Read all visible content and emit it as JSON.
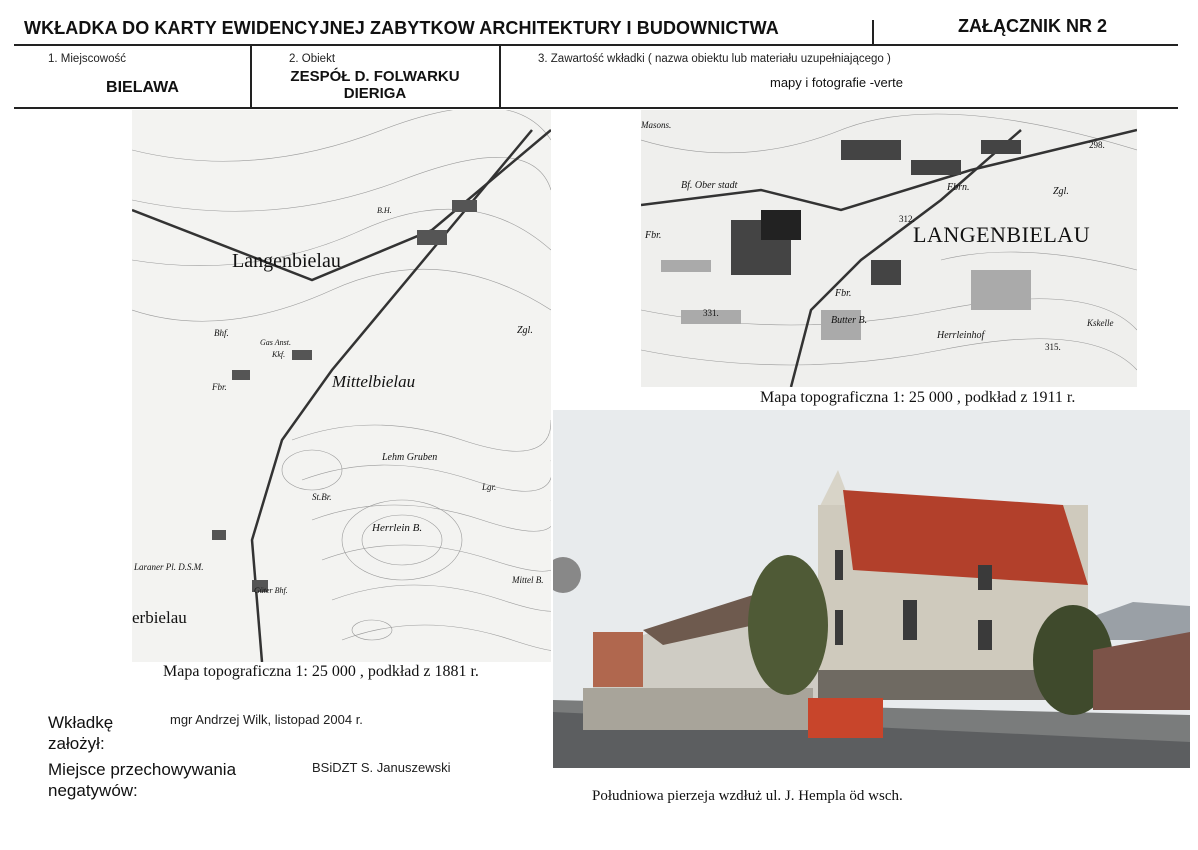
{
  "header": {
    "title": "WKŁADKA DO KARTY EWIDENCYJNEJ ZABYTKOW ARCHITEKTURY I BUDOWNICTWA",
    "annex": "ZAŁĄCZNIK NR  2"
  },
  "fields": {
    "locality": {
      "label": "1. Miejscowość",
      "value": "BIELAWA"
    },
    "object": {
      "label": "2. Obiekt",
      "value_line1": "ZESPÓŁ D. FOLWARKU",
      "value_line2": "DIERIGA"
    },
    "content": {
      "label": "3. Zawartość wkładki ( nazwa obiektu lub materiału uzupełniającego )",
      "value": "mapy i fotografie -verte"
    }
  },
  "maps": {
    "map1881": {
      "caption": "Mapa topograficzna 1: 25 000 , podkład z 1881 r.",
      "labels": [
        "Langenbielau",
        "Mittelbielau",
        "erbielau",
        "Herrlein B.",
        "Lehm Gruben",
        "Zgl.",
        "Fbr.",
        "Bhf.",
        "St.Br.",
        "Lgr.",
        "Mittel B.",
        "Laraner Pl. D.S.M.",
        "Güter Bhf.",
        "B.H.",
        "Gas Anst.",
        "Kkf."
      ]
    },
    "map1911": {
      "caption": "Mapa topograficzna 1: 25 000 , podkład z 1911 r.",
      "labels": [
        "LANGENBIELAU",
        "Bf. Ober stadt",
        "Fbrn.",
        "Fbr.",
        "Zgl.",
        "Butter B.",
        "Herrleinhof",
        "Fbr.",
        "Masons.",
        "312.",
        "331.",
        "315.",
        "298.",
        "Kskelle"
      ]
    }
  },
  "photo": {
    "caption": "Południowa pierzeja wzdłuż ul. J. Hempla öd wsch."
  },
  "footer": {
    "founded_label_1": "Wkładkę",
    "founded_label_2": "założył:",
    "founded_value": "mgr Andrzej Wilk, listopad 2004 r.",
    "storage_label_1": "Miejsce przechowywania",
    "storage_label_2": "negatywów:",
    "storage_value": "BSiDZT S. Januszewski"
  }
}
